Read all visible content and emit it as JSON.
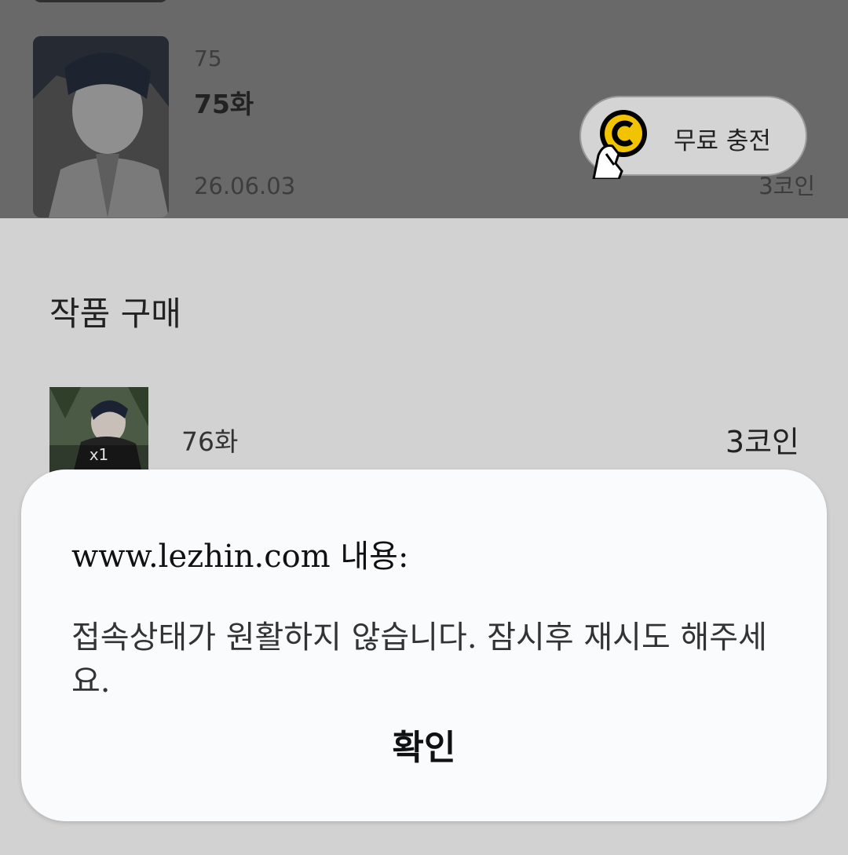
{
  "episode": {
    "number": "75",
    "title": "75화",
    "date": "26.06.03",
    "price": "3코인"
  },
  "free_charge": {
    "icon": "coin-hand-icon",
    "label": "무료 충전",
    "coin_color": "#f2c300"
  },
  "purchase": {
    "section_title": "작품 구매",
    "item": {
      "quantity": "x1",
      "title": "76화",
      "price": "3코인"
    }
  },
  "dialog": {
    "title": "www.lezhin.com 내용:",
    "message": "접속상태가 원활하지 않습니다. 잠시후 재시도 해주세요.",
    "confirm_label": "확인"
  }
}
